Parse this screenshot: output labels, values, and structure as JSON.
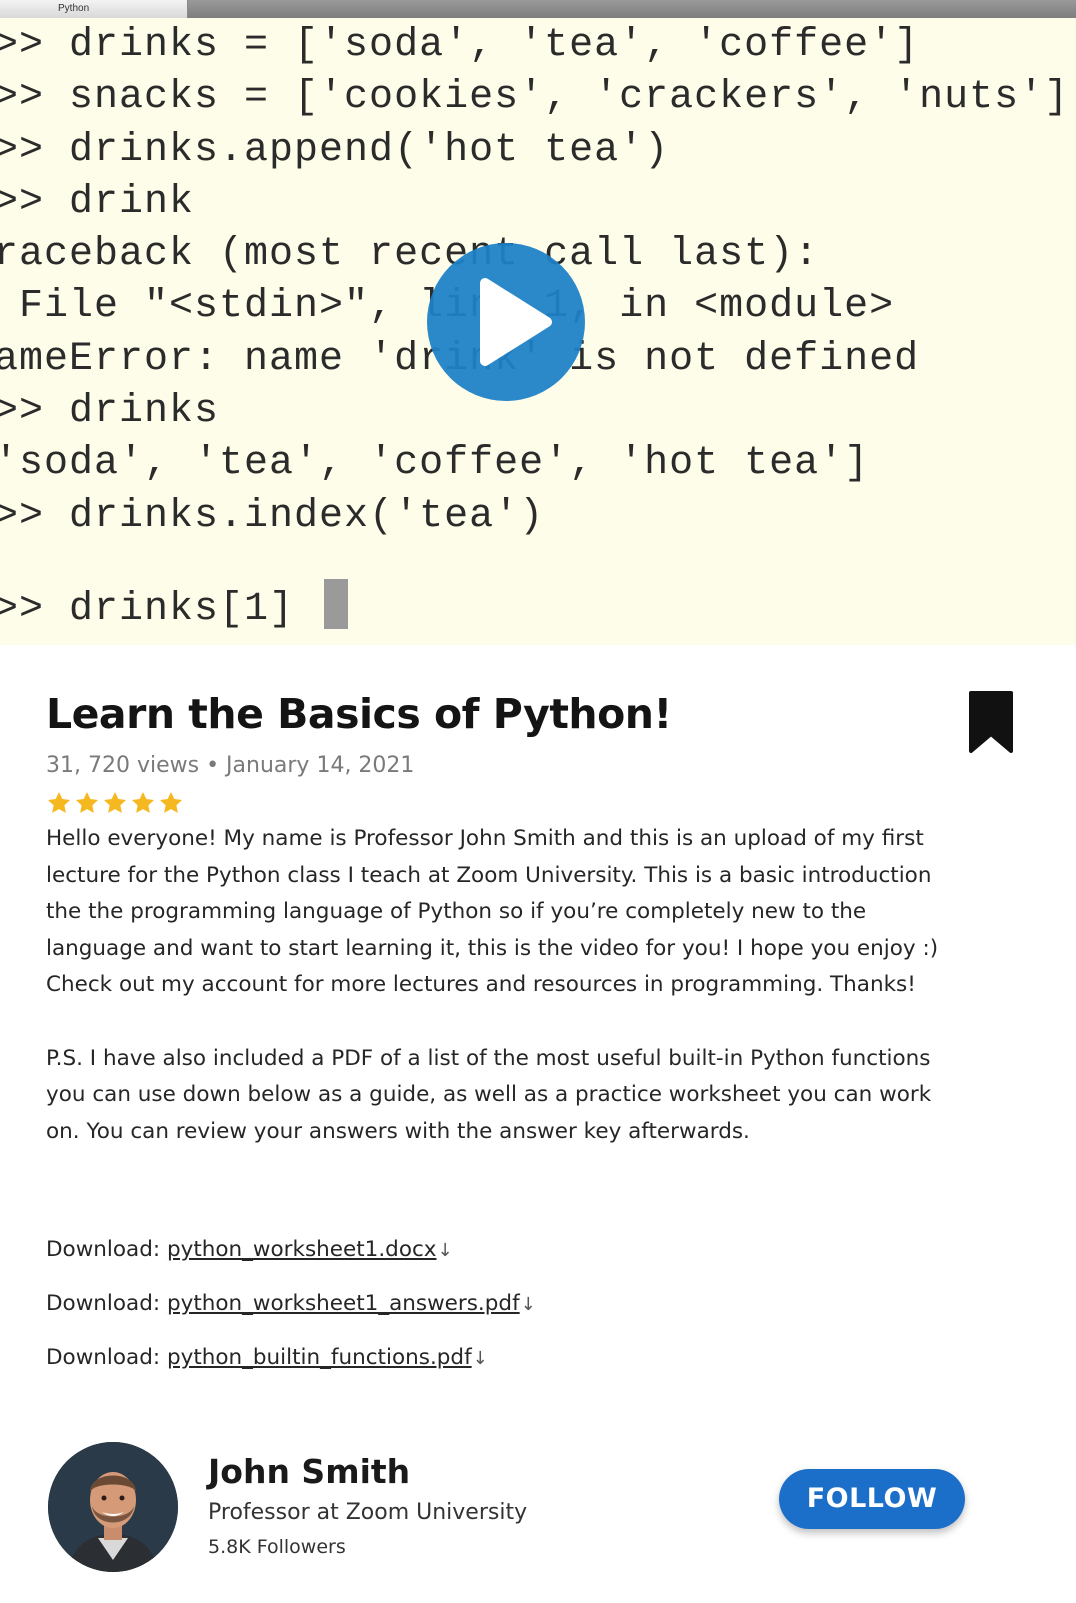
{
  "video": {
    "window_title": "Python",
    "console_lines": [
      ">> drinks = ['soda', 'tea', 'coffee']",
      ">> snacks = ['cookies', 'crackers', 'nuts']",
      ">> drinks.append('hot tea')",
      ">> drink",
      "raceback (most recent call last):",
      " File \"<stdin>\", line 1, in <module>",
      "ameError: name 'drink' is not defined",
      ">> drinks",
      "'soda', 'tea', 'coffee', 'hot tea']",
      ">> drinks.index('tea')",
      ">> drinks[1]"
    ],
    "play_icon": "play-icon",
    "play_color": "#1e82c8"
  },
  "post": {
    "title": "Learn the Basics of Python!",
    "meta": "31, 720 views • January 14, 2021",
    "rating": 5,
    "star_color": "#f6b820",
    "bookmark_icon": "bookmark-icon",
    "description_1": "Hello everyone! My name is Professor John Smith and this is an upload of my first lecture for the Python class I teach at Zoom University. This is a basic introduction the the programming language of Python so if you’re completely new to the language and want to start learning it, this is the video for you! I hope you enjoy :) Check out my account for more lectures and resources in programming. Thanks!",
    "description_2": "P.S. I have also included a PDF of a list of the most useful built-in Python functions you can use down below as a guide, as well as a practice worksheet you can work on. You can review your answers with the answer key afterwards.",
    "downloads": [
      {
        "label": "Download: ",
        "file": "python_worksheet1.docx",
        "arrow": "↓"
      },
      {
        "label": "Download: ",
        "file": "python_worksheet1_answers.pdf",
        "arrow": "↓"
      },
      {
        "label": "Download: ",
        "file": "python_builtin_functions.pdf",
        "arrow": "↓"
      }
    ]
  },
  "author": {
    "name": "John Smith",
    "role": "Professor at Zoom University",
    "followers": "5.8K Followers",
    "follow_label": "FOLLOW",
    "follow_color": "#1b6fc9"
  }
}
